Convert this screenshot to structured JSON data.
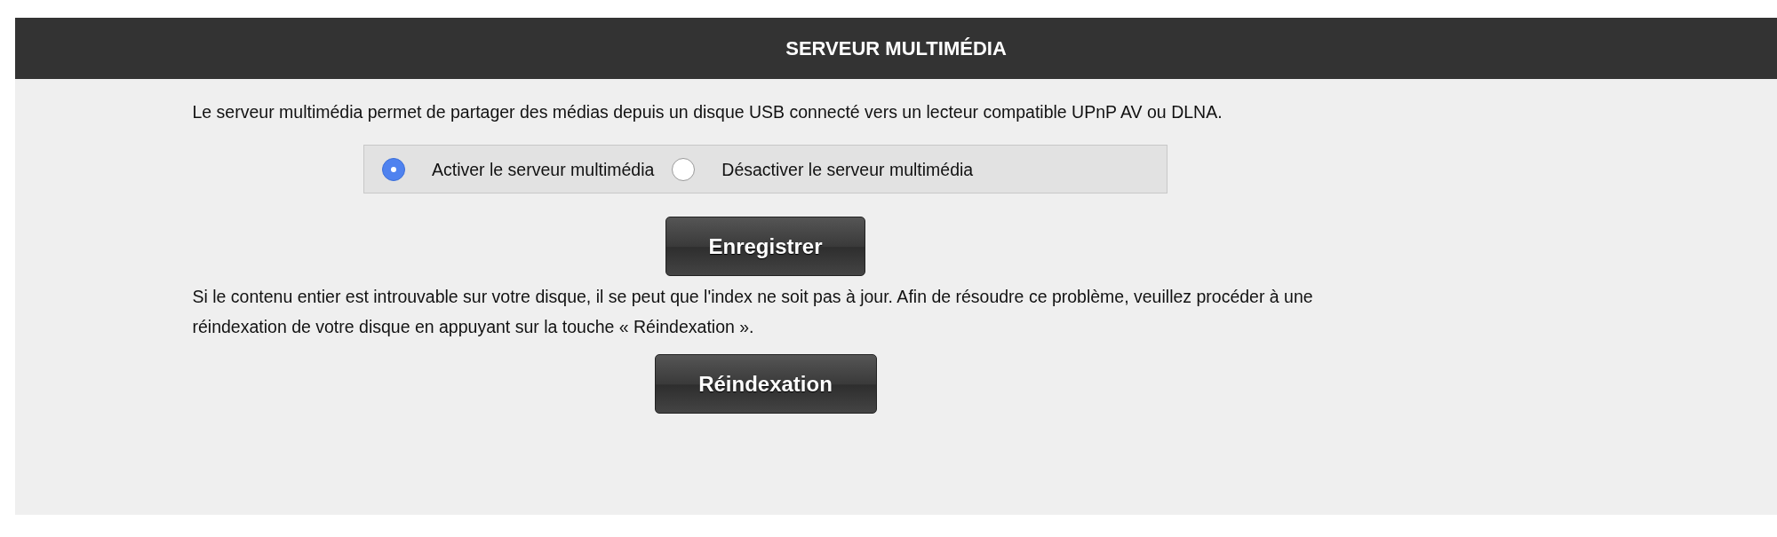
{
  "header": {
    "title": "SERVEUR MULTIMÉDIA"
  },
  "intro": "Le serveur multimédia permet de partager des médias depuis un disque USB connecté vers un lecteur compatible UPnP AV ou DLNA.",
  "options": [
    {
      "label": "Activer le serveur multimédia",
      "selected": true
    },
    {
      "label": "Désactiver le serveur multimédia",
      "selected": false
    }
  ],
  "save_button": "Enregistrer",
  "reindex_text": "Si le contenu entier est introuvable sur votre disque, il se peut que l'index ne soit pas à jour. Afin de résoudre ce problème, veuillez procéder à une réindexation de votre disque en appuyant sur la touche « Réindexation ».",
  "reindex_button": "Réindexation"
}
